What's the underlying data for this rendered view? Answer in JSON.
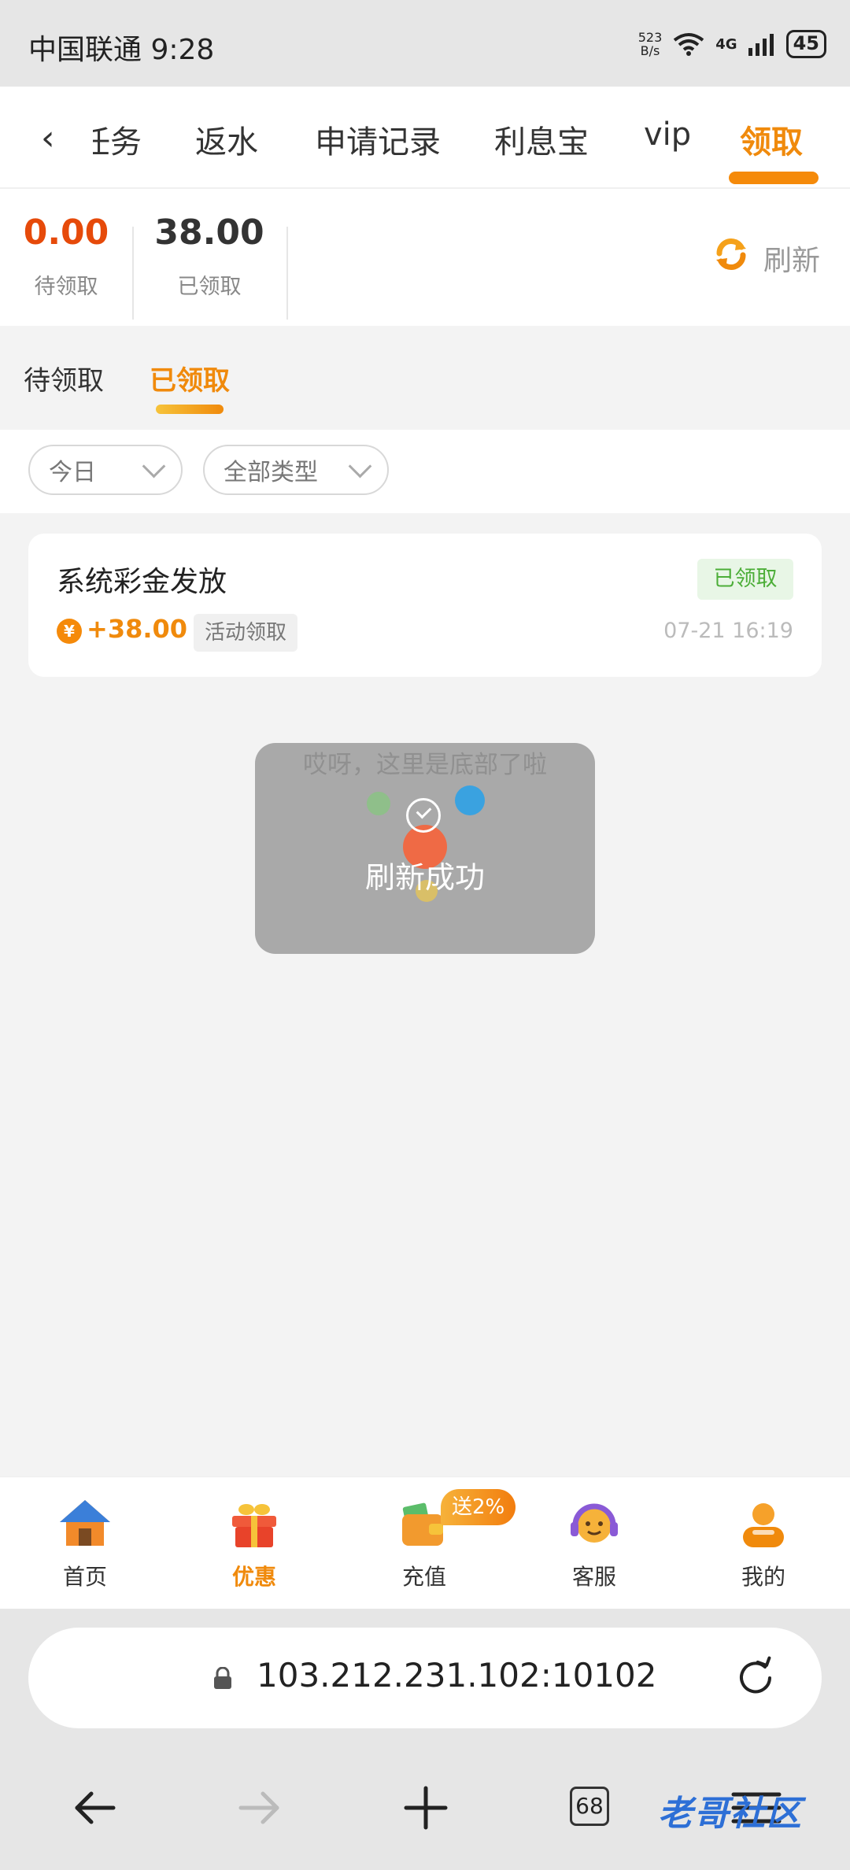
{
  "status": {
    "carrier_time": "中国联通 9:28",
    "net_speed_value": "523",
    "net_speed_unit": "B/s",
    "network": "4G",
    "battery": "45"
  },
  "tabs": [
    {
      "label": "任务"
    },
    {
      "label": "返水"
    },
    {
      "label": "申请记录"
    },
    {
      "label": "利息宝"
    },
    {
      "label": "vip"
    },
    {
      "label": "领取"
    }
  ],
  "stats": {
    "pending_value": "0.00",
    "pending_label": "待领取",
    "claimed_value": "38.00",
    "claimed_label": "已领取",
    "refresh_label": "刷新"
  },
  "subtabs": [
    {
      "label": "待领取"
    },
    {
      "label": "已领取"
    }
  ],
  "filters": {
    "date": "今日",
    "type": "全部类型"
  },
  "records": [
    {
      "title": "系统彩金发放",
      "status": "已领取",
      "coin": "¥",
      "amount": "+38.00",
      "tag": "活动领取",
      "time": "07-21 16:19"
    }
  ],
  "bottom_hint": "哎呀，这里是底部了啦",
  "toast": "刷新成功",
  "bottom_nav": {
    "items": [
      {
        "label": "首页",
        "icon": "house-icon"
      },
      {
        "label": "优惠",
        "icon": "gift-icon"
      },
      {
        "label": "充值",
        "icon": "wallet-icon"
      },
      {
        "label": "客服",
        "icon": "headset-icon"
      },
      {
        "label": "我的",
        "icon": "profile-icon"
      }
    ],
    "promo_badge": "送2%"
  },
  "browser": {
    "url": "103.212.231.102:10102",
    "tab_count": "68"
  },
  "watermark": "老哥社区",
  "colors": {
    "accent": "#f08a0c",
    "pending_value": "#e64a0a",
    "claimed_badge": "#4cae38"
  }
}
